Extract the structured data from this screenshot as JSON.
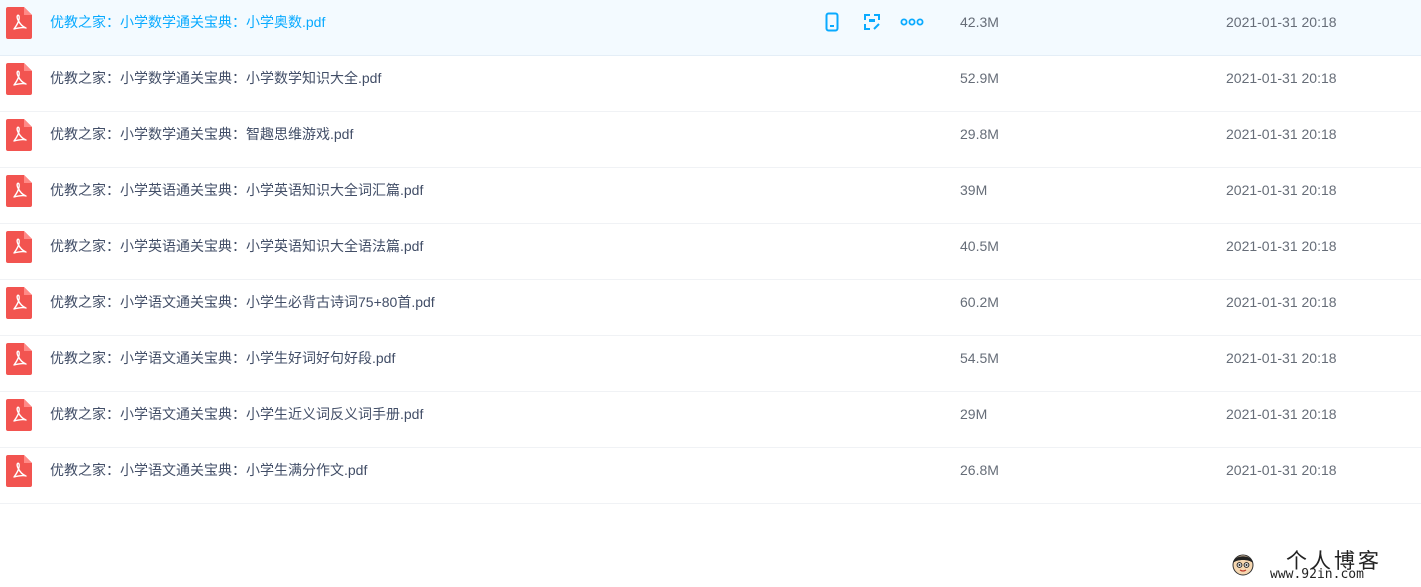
{
  "files": [
    {
      "name": "优教之家：小学数学通关宝典：小学奥数.pdf",
      "size": "42.3M",
      "modified": "2021-01-31 20:18",
      "hovered": true
    },
    {
      "name": "优教之家：小学数学通关宝典：小学数学知识大全.pdf",
      "size": "52.9M",
      "modified": "2021-01-31 20:18"
    },
    {
      "name": "优教之家：小学数学通关宝典：智趣思维游戏.pdf",
      "size": "29.8M",
      "modified": "2021-01-31 20:18"
    },
    {
      "name": "优教之家：小学英语通关宝典：小学英语知识大全词汇篇.pdf",
      "size": "39M",
      "modified": "2021-01-31 20:18"
    },
    {
      "name": "优教之家：小学英语通关宝典：小学英语知识大全语法篇.pdf",
      "size": "40.5M",
      "modified": "2021-01-31 20:18"
    },
    {
      "name": "优教之家：小学语文通关宝典：小学生必背古诗词75+80首.pdf",
      "size": "60.2M",
      "modified": "2021-01-31 20:18"
    },
    {
      "name": "优教之家：小学语文通关宝典：小学生好词好句好段.pdf",
      "size": "54.5M",
      "modified": "2021-01-31 20:18"
    },
    {
      "name": "优教之家：小学语文通关宝典：小学生近义词反义词手册.pdf",
      "size": "29M",
      "modified": "2021-01-31 20:18"
    },
    {
      "name": "优教之家：小学语文通关宝典：小学生满分作文.pdf",
      "size": "26.8M",
      "modified": "2021-01-31 20:18"
    }
  ],
  "row_actions": {
    "icons": [
      "phone-icon",
      "share-icon",
      "more-icon"
    ]
  },
  "watermark": {
    "title": "个人博客",
    "url": "www.92in.com"
  },
  "colors": {
    "accent": "#09aaff",
    "pdf_red": "#f25450",
    "text": "#424e67",
    "meta_text": "#666d78",
    "hover_bg": "#f3faff"
  }
}
